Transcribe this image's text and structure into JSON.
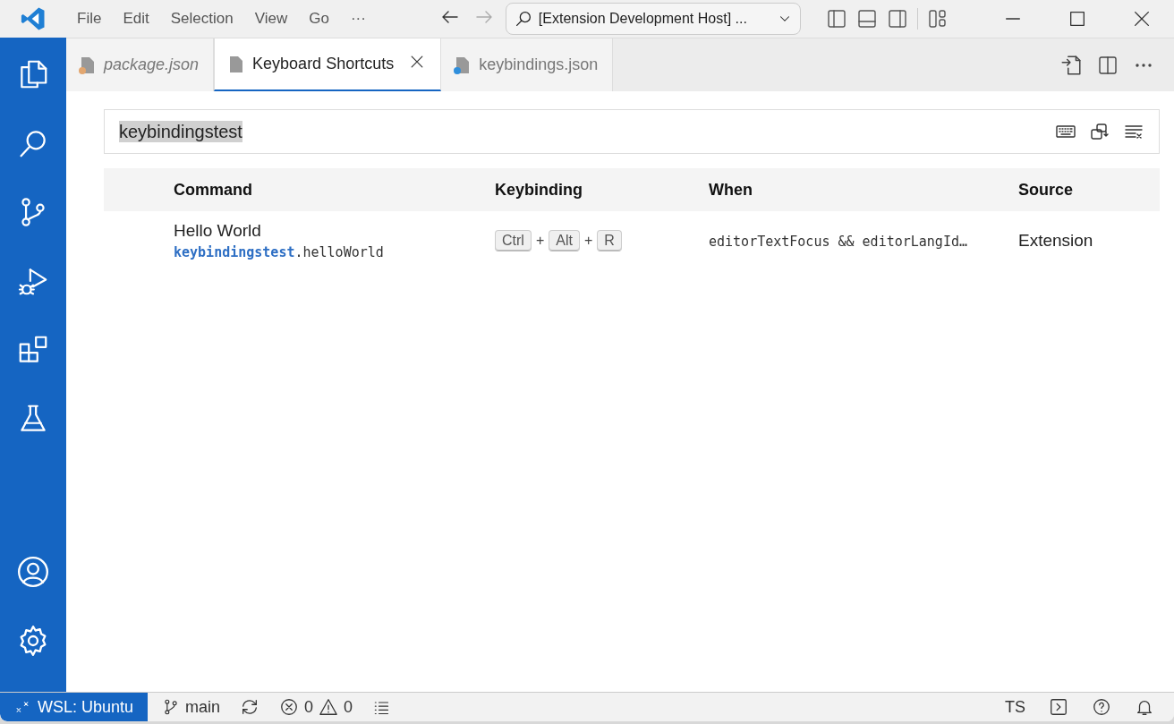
{
  "title_bar": {
    "menu": [
      "File",
      "Edit",
      "Selection",
      "View",
      "Go",
      "···"
    ],
    "command_center": "[Extension Development Host] ..."
  },
  "activity_bar": {
    "top": [
      {
        "kind": "explorer"
      },
      {
        "kind": "search"
      },
      {
        "kind": "source-control"
      },
      {
        "kind": "run-debug"
      },
      {
        "kind": "extensions"
      },
      {
        "kind": "testing"
      }
    ],
    "bottom": [
      {
        "kind": "accounts"
      },
      {
        "kind": "settings"
      }
    ]
  },
  "tabs": [
    {
      "label": "package.json",
      "selected": false,
      "preview": true,
      "color": "#e2a66f"
    },
    {
      "label": "Keyboard Shortcuts",
      "selected": true,
      "preview": false
    },
    {
      "label": "keybindings.json",
      "selected": false,
      "preview": false,
      "color": "#2f8fdc"
    }
  ],
  "search": {
    "value": "keybindingstest"
  },
  "table": {
    "columns": [
      "Command",
      "Keybinding",
      "When",
      "Source"
    ],
    "rows": [
      {
        "command": "Hello World",
        "command_id": "**keybindingstest**.helloWorld",
        "keybinding": [
          {
            "kind": "key",
            "text": "Ctrl"
          },
          {
            "kind": "plus",
            "text": "+"
          },
          {
            "kind": "key",
            "text": "Alt"
          },
          {
            "kind": "plus",
            "text": "+"
          },
          {
            "kind": "key",
            "text": "R"
          }
        ],
        "when": "editorTextFocus && editorLangId…",
        "source": "Extension"
      }
    ]
  },
  "status_bar": {
    "remote": "WSL: Ubuntu",
    "branch": "main",
    "errors": "0",
    "warnings": "0",
    "language": "TS"
  }
}
